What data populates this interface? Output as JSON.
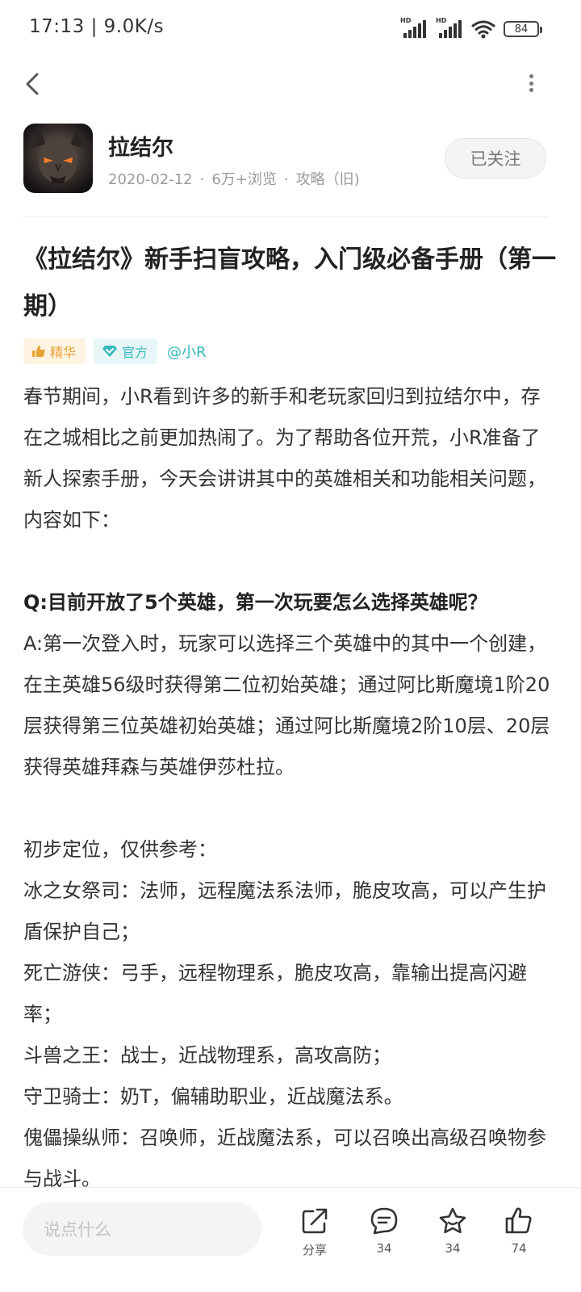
{
  "status": {
    "time": "17:13",
    "separator": "|",
    "speed": "9.0K/s",
    "battery": "84"
  },
  "author": {
    "name": "拉结尔",
    "date": "2020-02-12",
    "views": "6万+浏览",
    "category": "攻略（旧)",
    "follow_label": "已关注"
  },
  "article": {
    "title": "《拉结尔》新手扫盲攻略，入门级必备手册（第一期）",
    "tags": {
      "jinghua": "精华",
      "guanfang": "官方",
      "user": "@小R"
    },
    "paragraphs": [
      {
        "text": "春节期间，小R看到许多的新手和老玩家回归到拉结尔中，存在之城相比之前更加热闹了。为了帮助各位开荒，小R准备了新人探索手册，今天会讲讲其中的英雄相关和功能相关问题，内容如下：",
        "bold": false
      },
      {
        "text": "",
        "bold": false
      },
      {
        "text": "Q:目前开放了5个英雄，第一次玩要怎么选择英雄呢？",
        "bold": true
      },
      {
        "text": "A:第一次登入时，玩家可以选择三个英雄中的其中一个创建，在主英雄56级时获得第二位初始英雄；通过阿比斯魔境1阶20层获得第三位英雄初始英雄；通过阿比斯魔境2阶10层、20层获得英雄拜森与英雄伊莎杜拉。",
        "bold": false
      },
      {
        "text": "",
        "bold": false
      },
      {
        "text": "初步定位，仅供参考：",
        "bold": false
      },
      {
        "text": "冰之女祭司：法师，远程魔法系法师，脆皮攻高，可以产生护盾保护自己；",
        "bold": false
      },
      {
        "text": "死亡游侠：弓手，远程物理系，脆皮攻高，靠输出提高闪避率；",
        "bold": false
      },
      {
        "text": "斗兽之王：战士，近战物理系，高攻高防；",
        "bold": false
      },
      {
        "text": "守卫骑士：奶T，偏辅助职业，近战魔法系。",
        "bold": false
      },
      {
        "text": "傀儡操纵师：召唤师，近战魔法系，可以召唤出高级召唤物参与战斗。",
        "bold": false
      }
    ]
  },
  "bottom_bar": {
    "comment_placeholder": "说点什么",
    "share_label": "分享",
    "comment_count": "34",
    "star_count": "34",
    "like_count": "74"
  }
}
